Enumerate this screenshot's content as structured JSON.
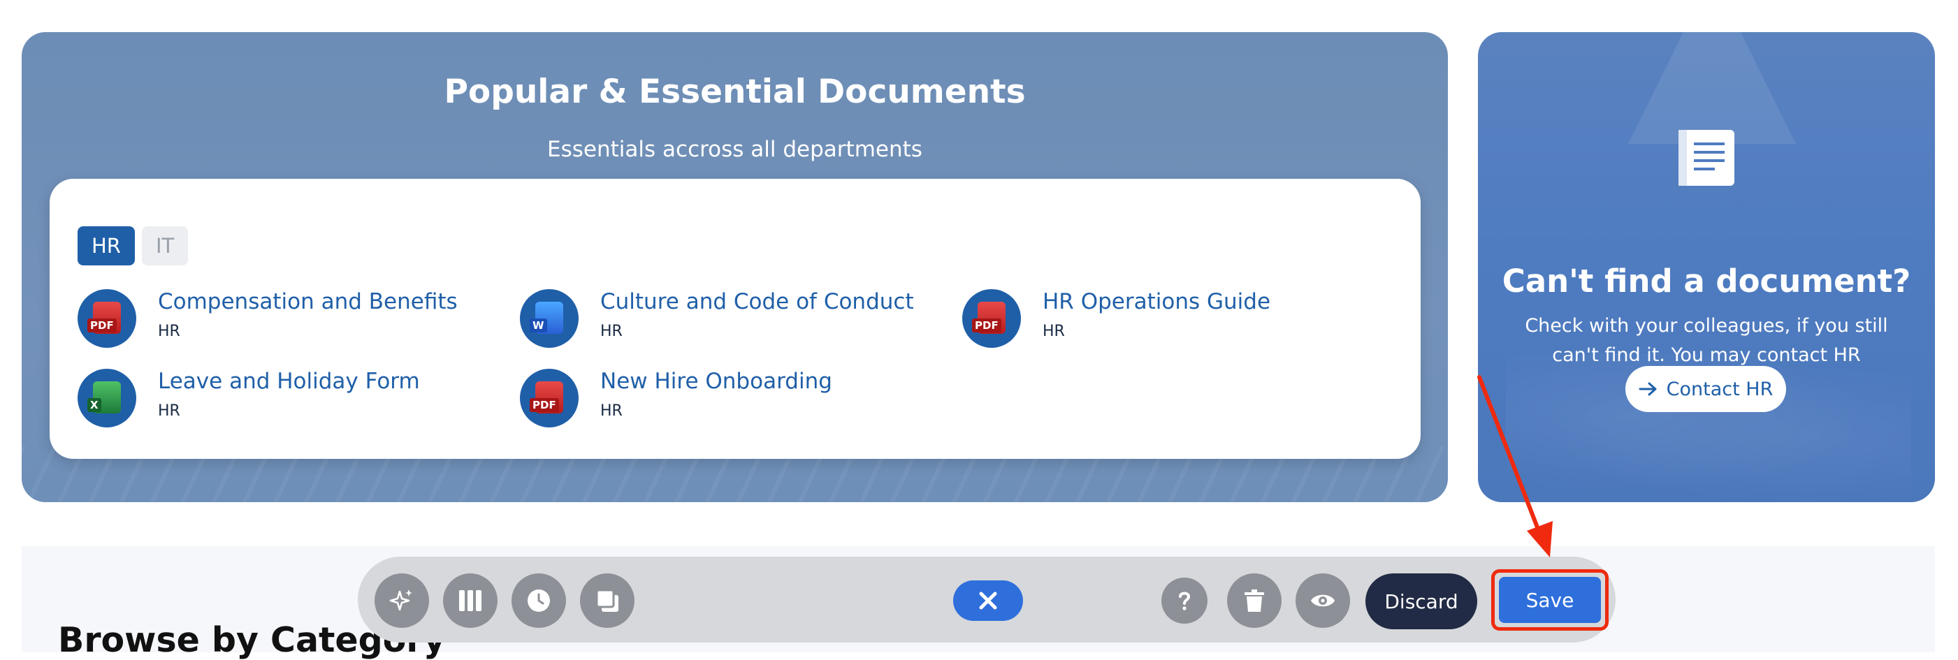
{
  "popular": {
    "title": "Popular & Essential Documents",
    "subtitle": "Essentials accross all departments",
    "tabs": [
      {
        "label": "HR",
        "active": true
      },
      {
        "label": "IT",
        "active": false
      }
    ],
    "documents": [
      {
        "title": "Compensation and Benefits",
        "dept": "HR",
        "type": "pdf",
        "badge": "PDF"
      },
      {
        "title": "Culture and Code of Conduct",
        "dept": "HR",
        "type": "word",
        "badge": "W"
      },
      {
        "title": "HR Operations Guide",
        "dept": "HR",
        "type": "pdf",
        "badge": "PDF"
      },
      {
        "title": "Leave and Holiday Form",
        "dept": "HR",
        "type": "excel",
        "badge": "X"
      },
      {
        "title": "New Hire Onboarding",
        "dept": "HR",
        "type": "pdf",
        "badge": "PDF"
      }
    ]
  },
  "contact": {
    "title": "Can't find a document?",
    "text": "Check with your colleagues, if you still can't find it. You may contact HR",
    "button_label": "Contact HR"
  },
  "browse": {
    "title": "Browse by Category"
  },
  "toolbar": {
    "left_icons": [
      "sparkle-icon",
      "columns-icon",
      "clock-icon",
      "layers-icon"
    ],
    "close_icon": "close-icon",
    "right_icons": [
      "help-icon",
      "trash-icon",
      "eye-icon"
    ],
    "discard_label": "Discard",
    "save_label": "Save"
  },
  "colors": {
    "accent": "#1f5fa8",
    "save_blue": "#2f6fdc",
    "discard_dark": "#222b45",
    "highlight_red": "#ef2a0e"
  }
}
